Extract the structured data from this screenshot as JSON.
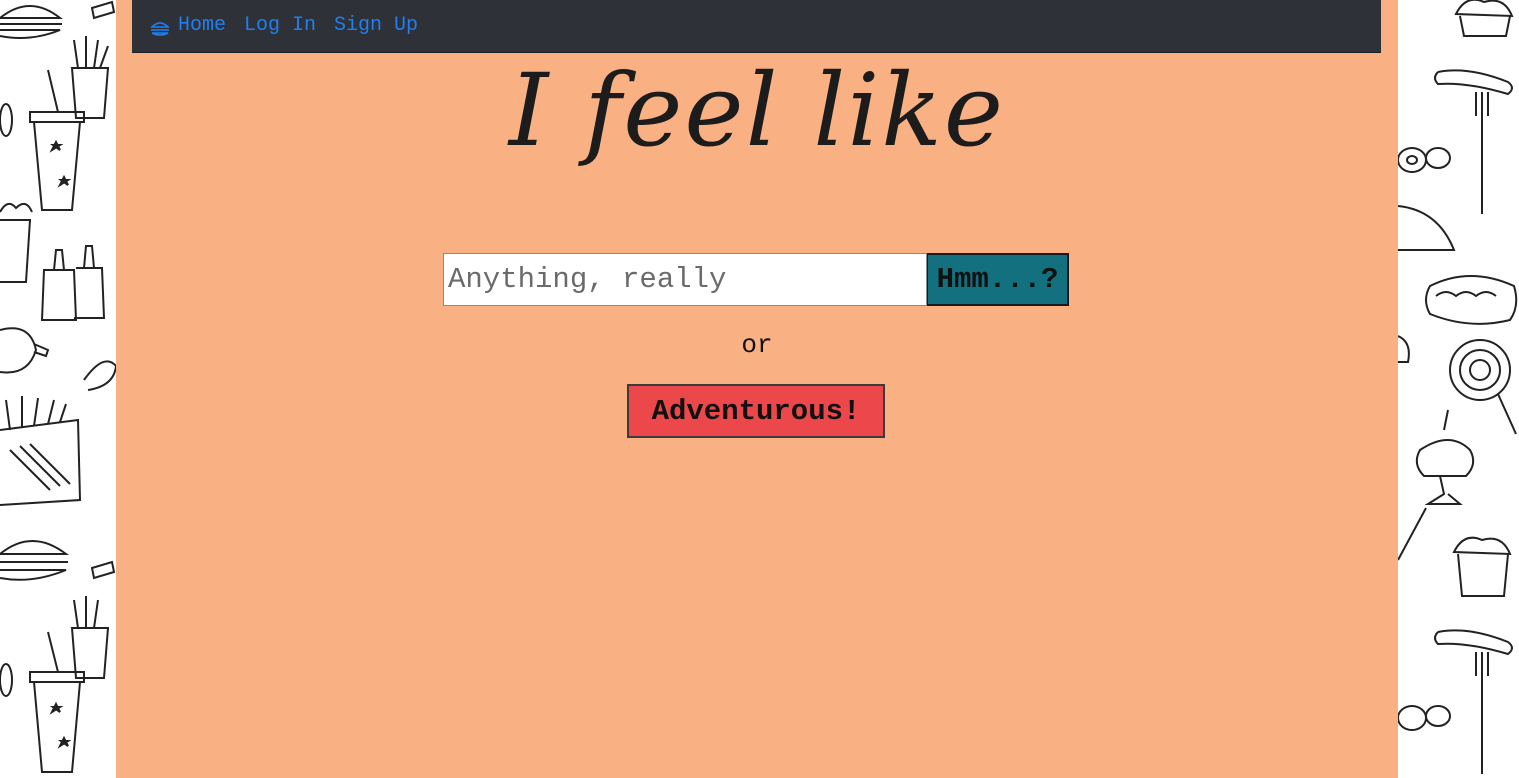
{
  "nav": {
    "home_icon": "burger-icon",
    "home_label": "Home",
    "login_label": "Log In",
    "signup_label": "Sign Up",
    "link_color": "#1f7ff0",
    "background": "#2e3238"
  },
  "hero": {
    "title": "I feel like"
  },
  "search": {
    "placeholder": "Anything, really",
    "value": "",
    "button_label": "Hmm...?",
    "button_color": "#13707e"
  },
  "divider_text": "or",
  "adventurous": {
    "label": "Adventurous!",
    "color": "#ec474b"
  },
  "theme": {
    "page_background": "#f9b082",
    "side_pattern": "food-doodle-pattern"
  }
}
